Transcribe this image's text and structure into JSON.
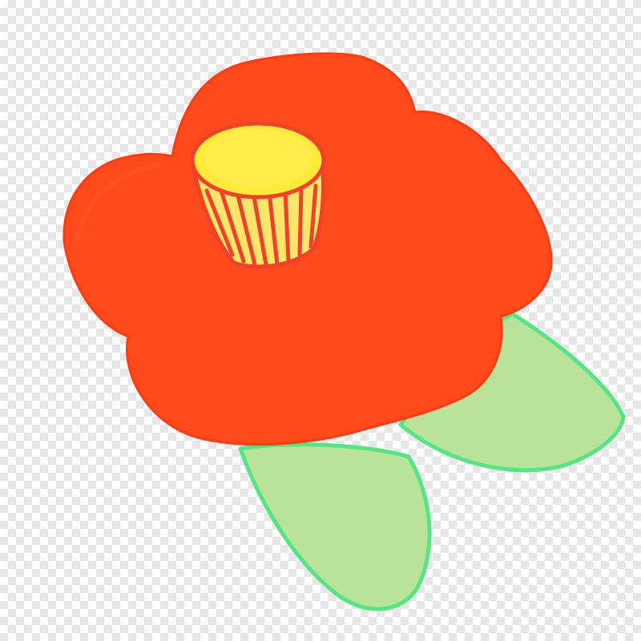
{
  "image": {
    "subject": "camellia-flower-clipart",
    "colors": {
      "petal": "#ff4a1c",
      "petal_edge": "#ff3a10",
      "leaf_fill": "#b9e29a",
      "leaf_edge": "#54e682",
      "stamen_cup": "#ffe56a",
      "stamen_top": "#ffe939",
      "stamen_stripe": "#f0412a",
      "checker_light": "#ffffff",
      "checker_dark": "#e6e6e6"
    },
    "background": "transparency-checkerboard"
  }
}
